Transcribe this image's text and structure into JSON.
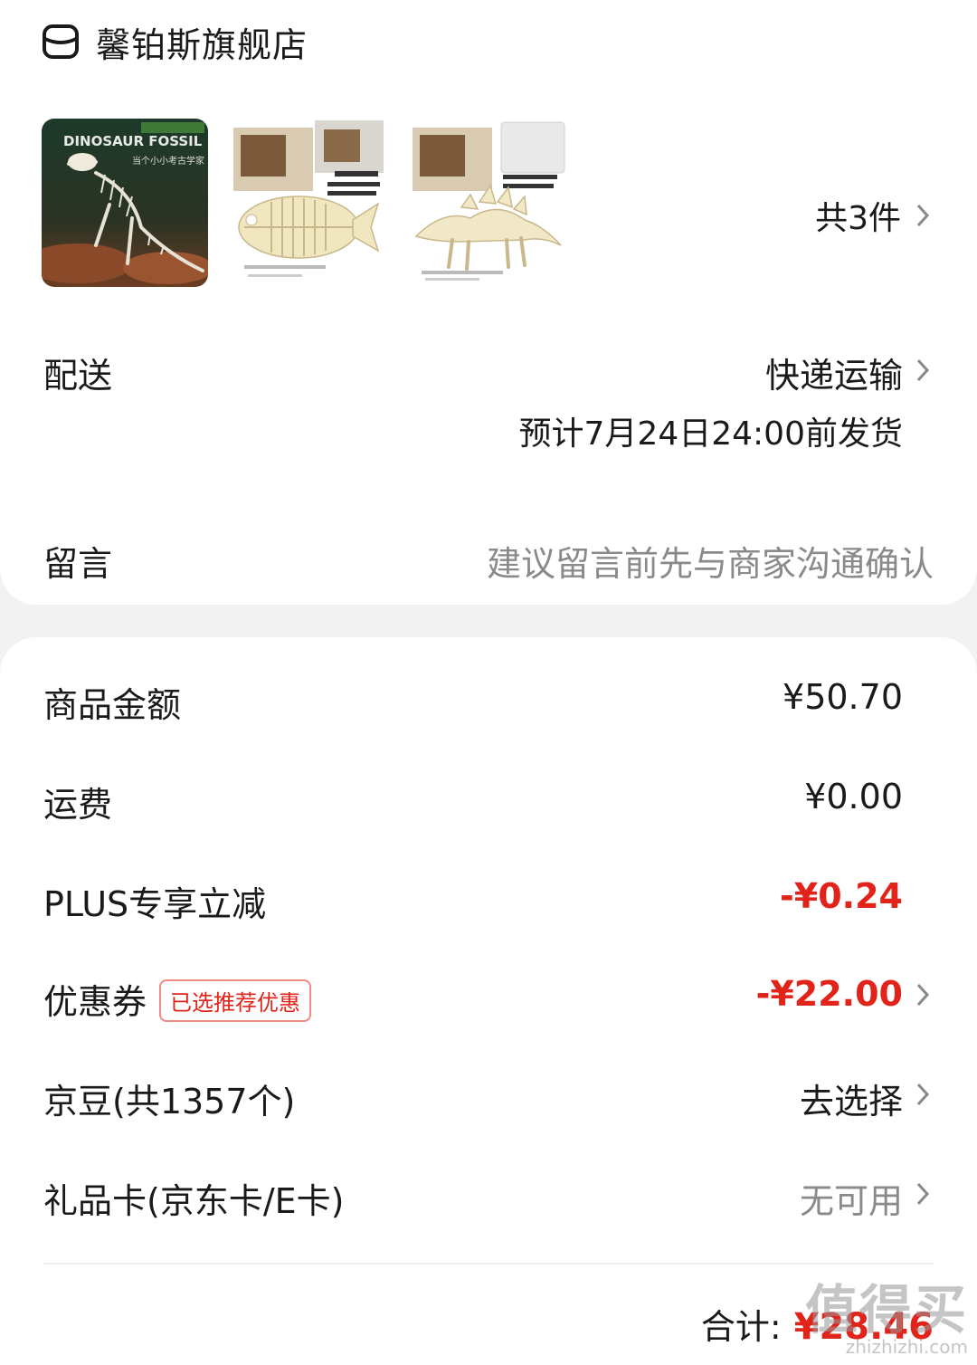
{
  "shop": {
    "icon": "store-icon",
    "name": "馨铂斯旗舰店"
  },
  "products": {
    "thumbnails": [
      {
        "name": "dinosaur-fossil-box",
        "text_line1": "DINOSAUR FOSSIL",
        "text_line2": "当个小小考古学家"
      },
      {
        "name": "fish-fossil-kit"
      },
      {
        "name": "stegosaurus-fossil-kit"
      }
    ],
    "count_label": "共3件"
  },
  "delivery": {
    "label": "配送",
    "method": "快递运输",
    "estimate": "预计7月24日24:00前发货"
  },
  "message": {
    "label": "留言",
    "placeholder": "建议留言前先与商家沟通确认"
  },
  "price": {
    "goods_label": "商品金额",
    "goods_value": "¥50.70",
    "shipping_label": "运费",
    "shipping_value": "¥0.00",
    "plus_label": "PLUS专享立减",
    "plus_value": "-¥0.24",
    "coupon_label": "优惠券",
    "coupon_badge": "已选推荐优惠",
    "coupon_value": "-¥22.00",
    "jingdou_label": "京豆(共1357个)",
    "jingdou_value": "去选择",
    "giftcard_label": "礼品卡(京东卡/E卡)",
    "giftcard_value": "无可用"
  },
  "total": {
    "label": "合计:",
    "value": "¥28.46"
  },
  "watermark": {
    "big": "值得买",
    "small": "zhizhizhi.com"
  },
  "colors": {
    "accent_red": "#e2231a",
    "grey_text": "#8a8a8a",
    "background": "#f2f2f2"
  }
}
